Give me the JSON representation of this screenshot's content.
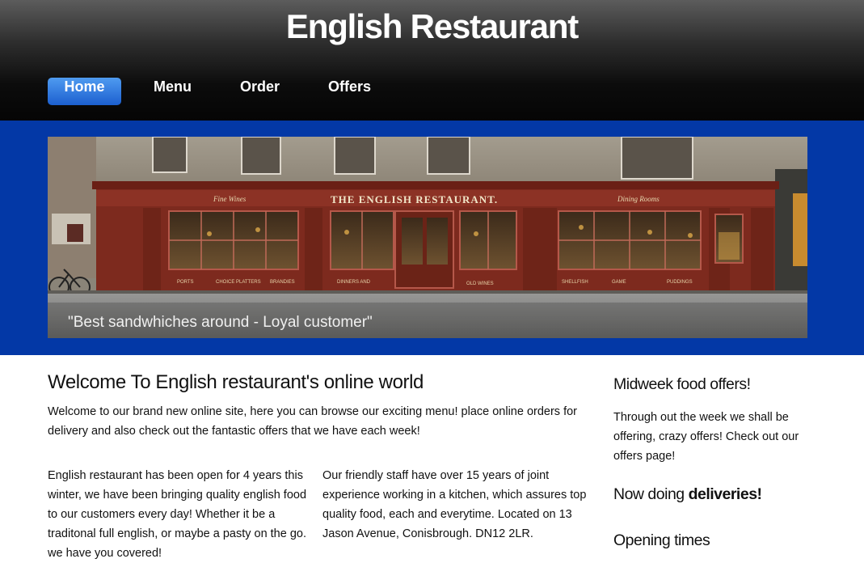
{
  "header": {
    "site_title": "English Restaurant",
    "nav": [
      {
        "label": "Home",
        "active": true
      },
      {
        "label": "Menu",
        "active": false
      },
      {
        "label": "Order",
        "active": false
      },
      {
        "label": "Offers",
        "active": false
      }
    ]
  },
  "banner": {
    "sign_text": "THE ENGLISH RESTAURANT.",
    "fascia_left": "Fine Wines",
    "fascia_right": "Dining Rooms",
    "window_labels": [
      "PORTS",
      "CHOICE PLATTERS",
      "BRANDIES",
      "DINNERS AND",
      "OLD WINES",
      "SHELLFISH",
      "GAME",
      "PUDDINGS"
    ],
    "caption": "\"Best sandwhiches around - Loyal customer\""
  },
  "main": {
    "welcome_title": "Welcome To English restaurant's online world",
    "intro": "Welcome to our brand new online site, here you can browse our exciting menu! place online orders for delivery and also check out the fantastic offers that we have each week!",
    "col_left": "English restaurant has been open for 4 years this winter, we have been bringing quality english food to our customers every day! Whether it be a traditonal full english, or maybe a pasty on the go. we have you covered!",
    "col_right": "Our friendly staff have over 15 years of joint experience working in a kitchen, which assures top quality food, each and everytime. Located on 13 Jason Avenue, Conisbrough. DN12 2LR."
  },
  "sidebar": {
    "offers_title": "Midweek food offers!",
    "offers_text": "Through out the week we shall be offering, crazy offers! Check out our offers page!",
    "deliveries_prefix": "Now doing",
    "deliveries_bold": "deliveries!",
    "opening_title": "Opening times"
  },
  "colors": {
    "banner_blue": "#0338a6",
    "nav_active": "#2a72e0",
    "header_dark": "#0c0c0c"
  }
}
